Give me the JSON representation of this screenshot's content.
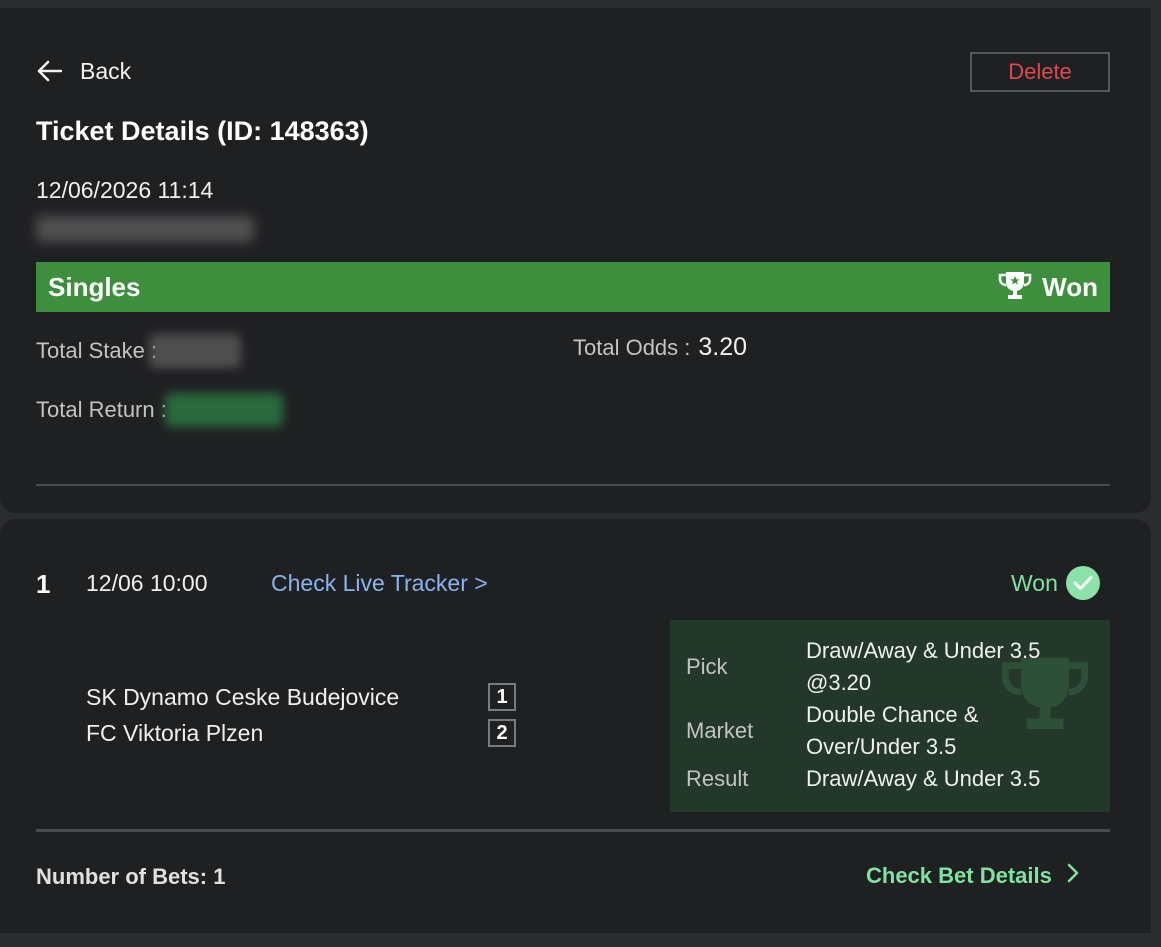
{
  "header": {
    "back_label": "Back",
    "delete_label": "Delete",
    "title": "Ticket Details (ID: 148363)",
    "datetime": "12/06/2026 11:14"
  },
  "banner": {
    "bet_type": "Singles",
    "status": "Won",
    "status_icon": "trophy-icon",
    "color": "#3d8f3e"
  },
  "summary": {
    "total_stake_label": "Total Stake :",
    "total_odds_label": "Total Odds :",
    "total_odds_value": "3.20",
    "total_return_label": "Total Return :"
  },
  "leg": {
    "index": "1",
    "time": "12/06 10:00",
    "live_tracker_label": "Check Live Tracker >",
    "status": "Won",
    "status_icon": "check-circle-icon",
    "home_team": "SK Dynamo Ceske Budejovice",
    "home_badge": "1",
    "away_team": "FC Viktoria Plzen",
    "away_badge": "2",
    "pick_label": "Pick",
    "pick_value": "Draw/Away & Under 3.5 @3.20",
    "market_label": "Market",
    "market_value": "Double Chance & Over/Under 3.5",
    "result_label": "Result",
    "result_value": "Draw/Away & Under 3.5"
  },
  "footer": {
    "number_of_bets_label": "Number of Bets: 1",
    "check_bet_details_label": "Check Bet Details",
    "accent_green": "#7fe3a0"
  },
  "colors": {
    "link_blue": "#8ab4f0",
    "delete_red": "#e0484f",
    "background": "#1f2022"
  }
}
